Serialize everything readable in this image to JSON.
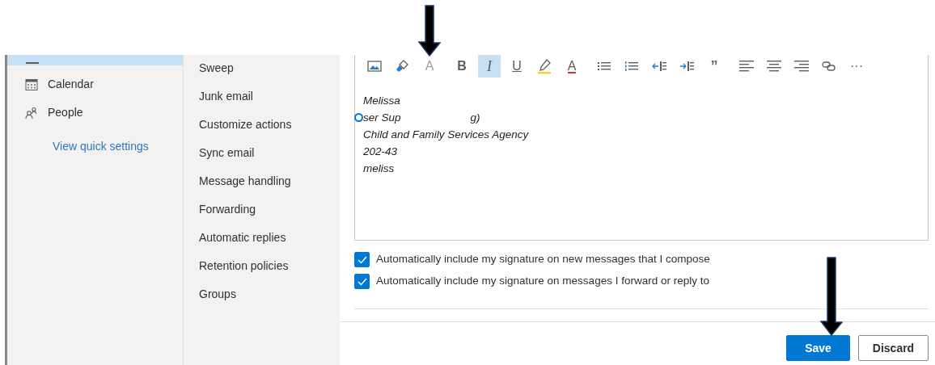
{
  "nav": {
    "items": [
      {
        "kind": "mail",
        "selected": true
      },
      {
        "kind": "calendar",
        "label": "Calendar",
        "selected": false
      },
      {
        "kind": "people",
        "label": "People",
        "selected": false
      }
    ],
    "link": "View quick settings"
  },
  "submenu": [
    "Sweep",
    "Junk email",
    "Customize actions",
    "Sync email",
    "Message handling",
    "Forwarding",
    "Automatic replies",
    "Retention policies",
    "Groups"
  ],
  "toolbar": [
    {
      "selected": false
    },
    {
      "selected": false
    },
    {
      "label": "A",
      "selected": false
    },
    {
      "label": "B",
      "selected": false
    },
    {
      "label": "I",
      "selected": true
    },
    {
      "label": "U",
      "selected": false
    },
    {
      "selected": false
    },
    {
      "label": "A",
      "selected": false
    },
    {
      "selected": false
    },
    {
      "selected": false
    },
    {
      "selected": false
    },
    {
      "selected": false
    },
    {
      "label": "”",
      "selected": false
    },
    {
      "selected": false
    },
    {
      "selected": false
    },
    {
      "selected": false
    },
    {
      "selected": false
    },
    {
      "label": "···",
      "selected": false
    }
  ],
  "signature": [
    {
      "parts": [
        "Melissa"
      ]
    },
    {
      "cursor": true,
      "parts": [
        "ser Sup",
        "g)"
      ]
    },
    {
      "parts": [
        "Child and Family Services Agency"
      ]
    },
    {
      "parts": [
        "202-43"
      ]
    },
    {
      "parts": [
        "meliss"
      ]
    }
  ],
  "options": [
    {
      "label": "Automatically include my signature on new messages that I compose",
      "checked": true
    },
    {
      "label": "Automatically include my signature on messages I forward or reply to",
      "checked": true
    }
  ],
  "buttons": [
    {
      "kind": "primary",
      "label": "Save"
    },
    {
      "kind": "secondary",
      "label": "Discard"
    }
  ],
  "annotations": [
    {
      "kind": "arrow"
    },
    {
      "kind": "arrow"
    }
  ]
}
